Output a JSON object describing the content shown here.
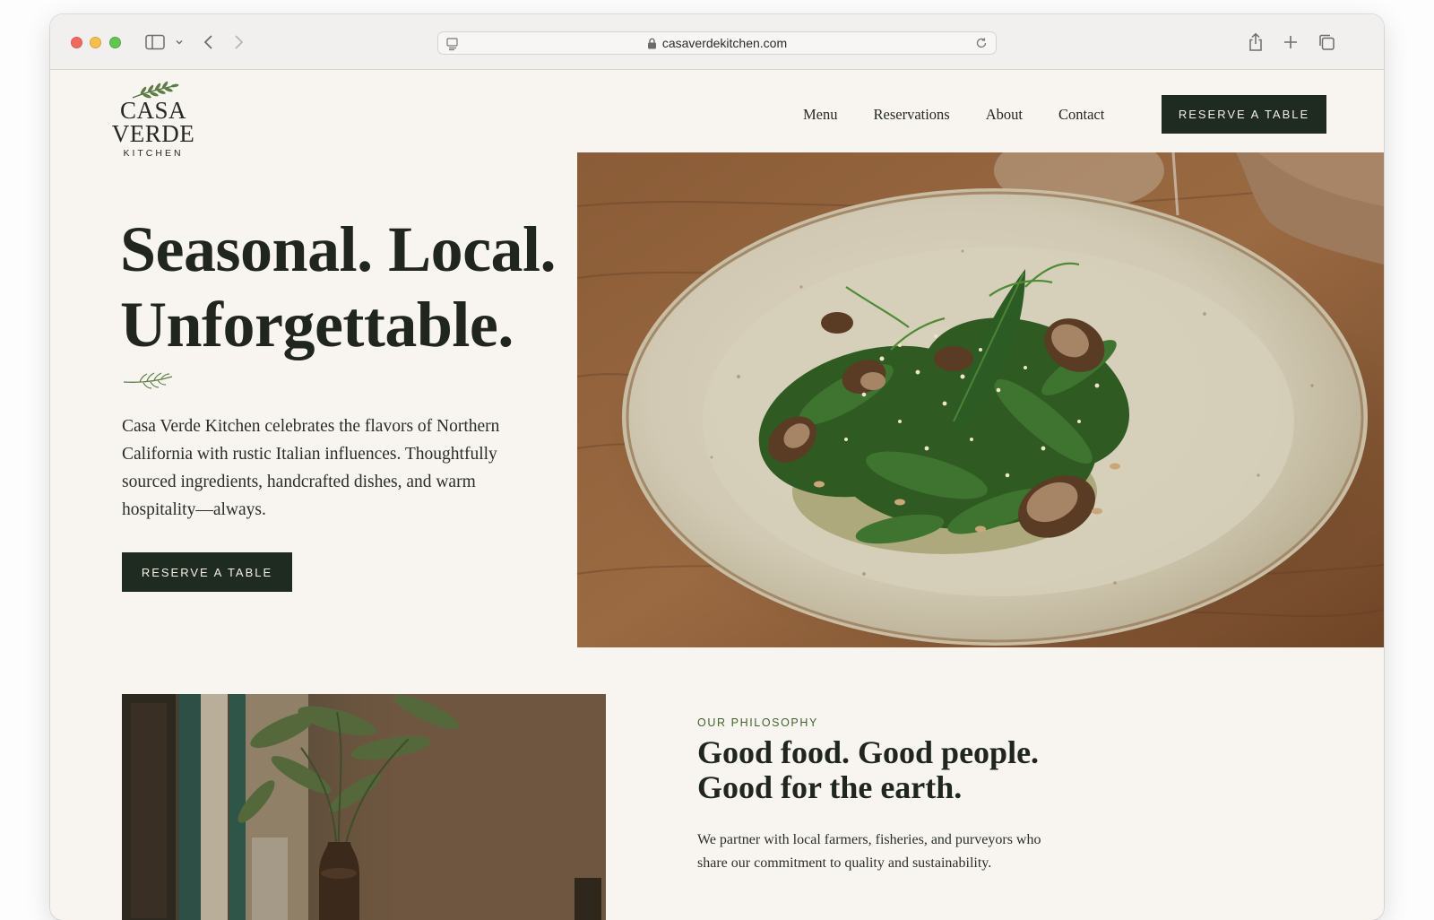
{
  "browser": {
    "url": "casaverdekitchen.com",
    "icons": [
      "sidebar-icon",
      "chevron-down-icon",
      "back-icon",
      "forward-icon",
      "page-icon",
      "lock-icon",
      "reload-icon",
      "share-icon",
      "new-tab-icon",
      "tabs-overview-icon"
    ]
  },
  "brand": {
    "name": "CASA VERDE",
    "subtitle": "KITCHEN"
  },
  "nav": {
    "items": [
      {
        "label": "Menu"
      },
      {
        "label": "Reservations"
      },
      {
        "label": "About"
      },
      {
        "label": "Contact"
      }
    ],
    "cta": "RESERVE A TABLE"
  },
  "hero": {
    "title_line1": "Seasonal. Local.",
    "title_line2": "Unforgettable.",
    "body": "Casa Verde Kitchen celebrates the flavors of Northern California with rustic Italian influences. Thoughtfully sourced ingredients, handcrafted dishes, and warm hospitality—always.",
    "cta": "RESERVE A TABLE"
  },
  "philosophy": {
    "eyebrow": "OUR PHILOSOPHY",
    "title_line1": "Good food. Good people.",
    "title_line2": "Good for the earth.",
    "body": "We partner with local farmers, fisheries, and purveyors who share our commitment to quality and sustainability."
  },
  "colors": {
    "background": "#f8f5f0",
    "button": "#1f2a20",
    "accent_green": "#41632e"
  }
}
